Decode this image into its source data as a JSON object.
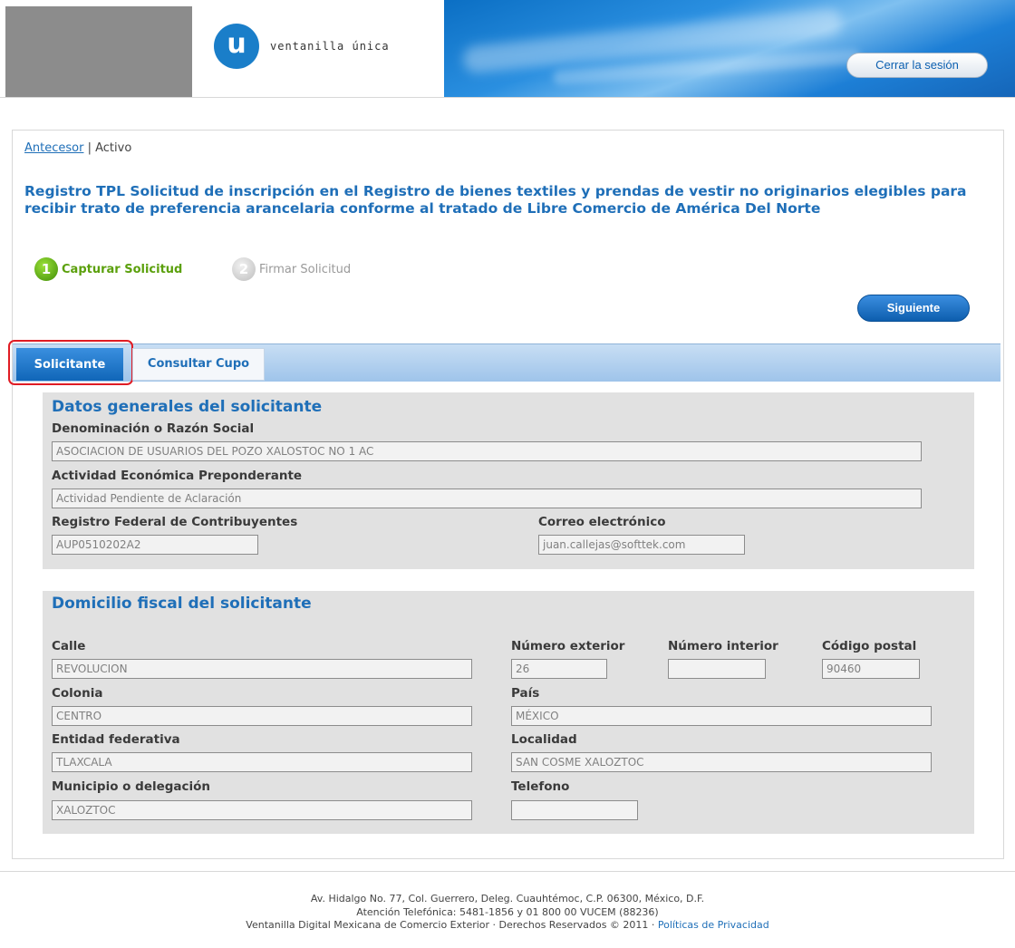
{
  "header": {
    "logo_letter": "u",
    "brand_name": "ventanilla única",
    "logout_label": "Cerrar la sesión"
  },
  "breadcrumb": {
    "parent_link": "Antecesor",
    "separator": "|",
    "current": "Activo"
  },
  "page_title": "Registro TPL Solicitud de inscripción en el Registro de bienes textiles y prendas de vestir no originarios elegibles para recibir trato de preferencia arancelaria conforme al tratado de Libre Comercio de América Del Norte",
  "steps": [
    {
      "number": "1",
      "label": "Capturar Solicitud"
    },
    {
      "number": "2",
      "label": "Firmar Solicitud"
    }
  ],
  "next_label": "Siguiente",
  "tabs": [
    {
      "label": "Solicitante"
    },
    {
      "label": "Consultar Cupo"
    }
  ],
  "general": {
    "title": "Datos generales del solicitante",
    "razon_social_label": "Denominación o Razón Social",
    "razon_social_value": "ASOCIACION DE USUARIOS DEL POZO XALOSTOC NO 1 AC",
    "actividad_label": "Actividad Económica Preponderante",
    "actividad_value": "Actividad Pendiente de Aclaración",
    "rfc_label": "Registro Federal de Contribuyentes",
    "rfc_value": "AUP0510202A2",
    "email_label": "Correo electrónico",
    "email_value": "juan.callejas@softtek.com"
  },
  "domicilio": {
    "title": "Domicilio fiscal del solicitante",
    "calle_label": "Calle",
    "calle_value": "REVOLUCION",
    "num_ext_label": "Número exterior",
    "num_ext_value": "26",
    "num_int_label": "Número interior",
    "num_int_value": "",
    "cp_label": "Código postal",
    "cp_value": "90460",
    "colonia_label": "Colonia",
    "colonia_value": "CENTRO",
    "pais_label": "País",
    "pais_value": "MÉXICO",
    "entidad_label": "Entidad federativa",
    "entidad_value": "TLAXCALA",
    "localidad_label": "Localidad",
    "localidad_value": "SAN COSME XALOZTOC",
    "municipio_label": "Municipio o delegación",
    "municipio_value": "XALOZTOC",
    "telefono_label": "Telefono",
    "telefono_value": ""
  },
  "footer": {
    "line1": "Av. Hidalgo No. 77, Col. Guerrero, Deleg. Cuauhtémoc, C.P. 06300, México, D.F.",
    "line2": "Atención Telefónica: 5481-1856 y 01 800 00 VUCEM (88236)",
    "line3": "Ventanilla Digital Mexicana de Comercio Exterior · Derechos Reservados © 2011 ·",
    "privacy_link": "Políticas de Privacidad"
  },
  "colors": {
    "accent_blue": "#1f6fb8",
    "step_active_green": "#5ba00c",
    "highlight_red": "#e01c24"
  }
}
